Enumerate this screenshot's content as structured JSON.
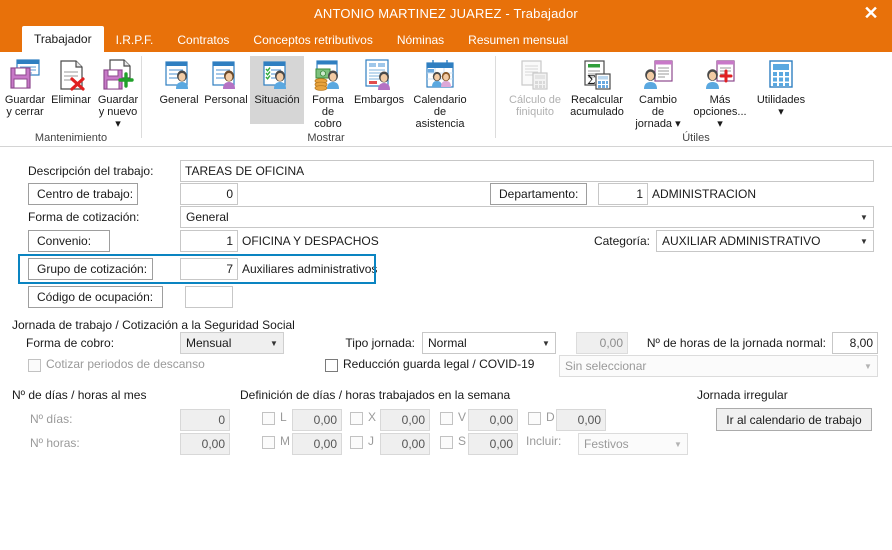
{
  "window": {
    "title": "ANTONIO MARTINEZ JUAREZ - Trabajador",
    "close_label": "✕",
    "accent_color": "#e8710a",
    "highlight_color": "#0a84c1"
  },
  "tabs": [
    {
      "label": "Trabajador",
      "active": true
    },
    {
      "label": "I.R.P.F.",
      "active": false
    },
    {
      "label": "Contratos",
      "active": false
    },
    {
      "label": "Conceptos retributivos",
      "active": false
    },
    {
      "label": "Nóminas",
      "active": false
    },
    {
      "label": "Resumen mensual",
      "active": false
    }
  ],
  "ribbon": {
    "groups": [
      {
        "title": "Mantenimiento",
        "buttons": [
          {
            "label": "Guardar\ny cerrar",
            "icon": "save-close-icon",
            "state": "normal"
          },
          {
            "label": "Eliminar",
            "icon": "delete-icon",
            "state": "normal"
          },
          {
            "label": "Guardar\ny nuevo ▾",
            "icon": "save-new-icon",
            "state": "normal"
          }
        ]
      },
      {
        "title": "Mostrar",
        "buttons": [
          {
            "label": "General",
            "icon": "general-person-icon",
            "state": "normal"
          },
          {
            "label": "Personal",
            "icon": "personal-person-icon",
            "state": "normal"
          },
          {
            "label": "Situación",
            "icon": "situacion-person-icon",
            "state": "selected"
          },
          {
            "label": "Forma\nde cobro",
            "icon": "forma-cobro-icon",
            "state": "normal"
          },
          {
            "label": "Embargos",
            "icon": "embargos-icon",
            "state": "normal"
          },
          {
            "label": "Calendario\nde asistencia",
            "icon": "calendario-asistencia-icon",
            "state": "normal"
          }
        ]
      },
      {
        "title": "Útiles",
        "buttons": [
          {
            "label": "Cálculo de\nfiniquito",
            "icon": "calculo-finiquito-icon",
            "state": "disabled"
          },
          {
            "label": "Recalcular\nacumulado",
            "icon": "recalcular-acumulado-icon",
            "state": "normal"
          },
          {
            "label": "Cambio de\njornada ▾",
            "icon": "cambio-jornada-icon",
            "state": "normal"
          },
          {
            "label": "Más\nopciones... ▾",
            "icon": "mas-opciones-icon",
            "state": "normal"
          },
          {
            "label": "Utilidades\n▾",
            "icon": "utilidades-icon",
            "state": "normal"
          }
        ]
      }
    ]
  },
  "form": {
    "descripcion_label": "Descripción del trabajo:",
    "descripcion_value": "TAREAS DE OFICINA",
    "centro_label": "Centro de trabajo:",
    "centro_value": "0",
    "departamento_label": "Departamento:",
    "departamento_code": "1",
    "departamento_name": "ADMINISTRACION",
    "forma_cotizacion_label": "Forma de cotización:",
    "forma_cotizacion_value": "General",
    "convenio_label": "Convenio:",
    "convenio_code": "1",
    "convenio_name": "OFICINA Y DESPACHOS",
    "categoria_label": "Categoría:",
    "categoria_value": "AUXILIAR ADMINISTRATIVO",
    "grupo_label": "Grupo de cotización:",
    "grupo_code": "7",
    "grupo_name": "Auxiliares administrativos",
    "ocupacion_label": "Código de ocupación:",
    "ocupacion_value": ""
  },
  "jornada": {
    "section_title": "Jornada de trabajo / Cotización a la Seguridad Social",
    "forma_cobro_label": "Forma de cobro:",
    "forma_cobro_value": "Mensual",
    "cotizar_descanso_label": "Cotizar periodos de descanso",
    "cotizar_descanso_checked": false,
    "tipo_jornada_label": "Tipo jornada:",
    "tipo_jornada_value": "Normal",
    "tipo_jornada_pct": "0,00",
    "reduccion_label": "Reducción guarda legal / COVID-19",
    "reduccion_checked": false,
    "reduccion_value": "Sin seleccionar",
    "horas_normal_label": "Nº de horas de la jornada normal:",
    "horas_normal_value": "8,00"
  },
  "mes": {
    "section_title": "Nº de días / horas al mes",
    "dias_label": "Nº días:",
    "dias_value": "0",
    "horas_label": "Nº horas:",
    "horas_value": "0,00"
  },
  "semana": {
    "section_title": "Definición de días / horas trabajados en la semana",
    "days": [
      {
        "code": "L",
        "value": "0,00",
        "checked": false
      },
      {
        "code": "M",
        "value": "0,00",
        "checked": false
      },
      {
        "code": "X",
        "value": "0,00",
        "checked": false
      },
      {
        "code": "J",
        "value": "0,00",
        "checked": false
      },
      {
        "code": "V",
        "value": "0,00",
        "checked": false
      },
      {
        "code": "S",
        "value": "0,00",
        "checked": false
      },
      {
        "code": "D",
        "value": "0,00",
        "checked": false
      }
    ],
    "incluir_label": "Incluir:",
    "incluir_value": "Festivos"
  },
  "irregular": {
    "section_title": "Jornada irregular",
    "button_label": "Ir al calendario de trabajo"
  }
}
